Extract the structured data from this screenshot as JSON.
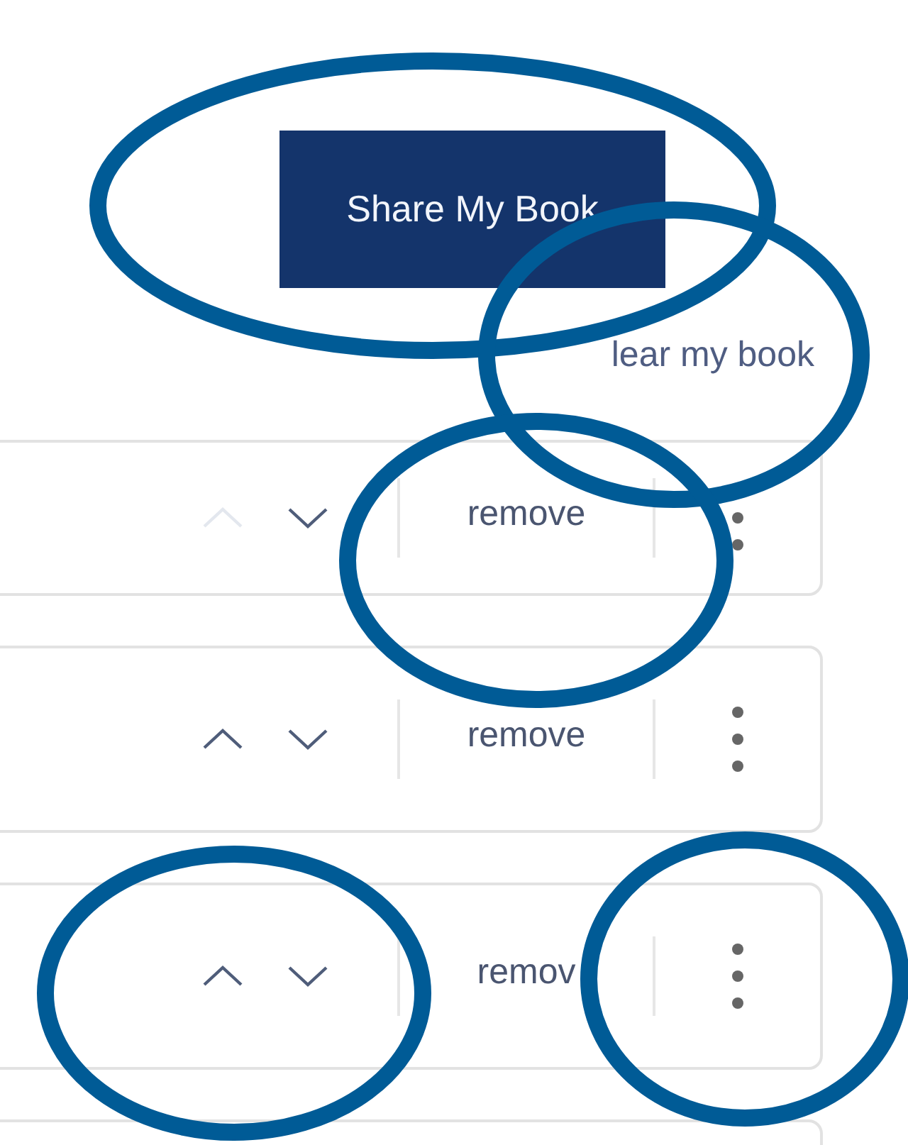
{
  "share_button": {
    "label": "Share My Book"
  },
  "clear_link": {
    "label": "lear my book"
  },
  "rows": [
    {
      "kind": "item",
      "can_move_up": false,
      "remove_label": "remove"
    },
    {
      "kind": "item",
      "can_move_up": true,
      "remove_label": "remove"
    },
    {
      "kind": "item",
      "can_move_up": true,
      "remove_label": "remov"
    },
    {
      "kind": "cut"
    }
  ]
}
